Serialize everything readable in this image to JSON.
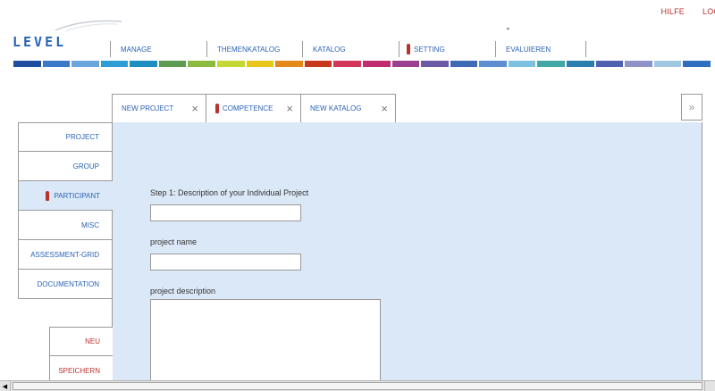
{
  "top_links": [
    "HILFE",
    "LOG"
  ],
  "logo": {
    "text": "LEVEL"
  },
  "main_nav": [
    {
      "label": "MANAGE",
      "active": false
    },
    {
      "label": "THEMENKATALOG",
      "active": false
    },
    {
      "label": "KATALOG",
      "active": false
    },
    {
      "label": "SETTING",
      "active": true
    },
    {
      "label": "EVALUIEREN",
      "active": false
    }
  ],
  "color_strip": [
    "#1f4ea0",
    "#3a78c8",
    "#6aa5dd",
    "#2e9dd6",
    "#1c8fc0",
    "#5e9b52",
    "#8cbc3f",
    "#c5d734",
    "#e9c61b",
    "#e48a1b",
    "#c8381e",
    "#d3355c",
    "#c12c70",
    "#9c3f8f",
    "#6b5ba6",
    "#3f6ab5",
    "#5d8ed0",
    "#7cc1e1",
    "#42a8a5",
    "#2b7fae",
    "#5061b0",
    "#8f93c8",
    "#a0c8e2",
    "#2f6fbf"
  ],
  "tabs": [
    {
      "label": "NEW PROJECT",
      "icon": false,
      "close_icon": "×"
    },
    {
      "label": "COMPETENCE",
      "icon": true,
      "close_icon": "×"
    },
    {
      "label": "NEW KATALOG",
      "icon": false,
      "close_icon": "×"
    }
  ],
  "tab_scroll_icon": "»",
  "side_menu": [
    {
      "label": "PROJECT",
      "active": false
    },
    {
      "label": "GROUP",
      "active": false
    },
    {
      "label": "PARTICIPANT",
      "active": true
    },
    {
      "label": "MISC",
      "active": false
    },
    {
      "label": "ASSESSMENT-GRID",
      "active": false
    },
    {
      "label": "DOCUMENTATION",
      "active": false
    }
  ],
  "side_actions": [
    "NEU",
    "SPEICHERN"
  ],
  "form": {
    "step_label": "Step 1: Description of your Individual Project",
    "step_value": "",
    "name_label": "project name",
    "name_value": "",
    "description_label": "project description",
    "description_value": ""
  },
  "scrollbar": {
    "left_arrow": "◀"
  },
  "colors": {
    "accent_red": "#b8332e",
    "link_blue": "#2a63b6",
    "panel_bg": "#dbe8f7"
  }
}
